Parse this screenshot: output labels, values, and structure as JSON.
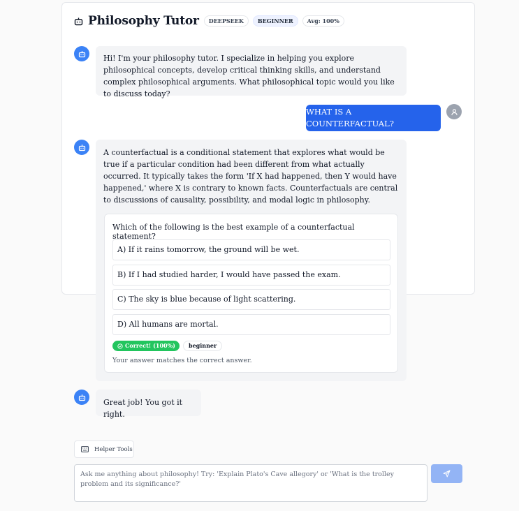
{
  "header": {
    "title": "Philosophy Tutor",
    "badges": [
      "DEEPSEEK",
      "BEGINNER",
      "Avg: 100%"
    ]
  },
  "messages": {
    "intro": "Hi! I'm your philosophy tutor. I specialize in helping you explore philosophical concepts, develop critical thinking skills, and understand complex philosophical arguments. What philosophical topic would you like to discuss today?",
    "user_question": "WHAT IS A COUNTERFACTUAL?",
    "answer": "A counterfactual is a conditional statement that explores what would be true if a particular condition had been different from what actually occurred. It typically takes the form 'If X had happened, then Y would have happened,' where X is contrary to known facts. Counterfactuals are central to discussions of causality, possibility, and modal logic in philosophy.",
    "followup": "Great job! You got it right."
  },
  "quiz": {
    "question": "Which of the following is the best example of a counterfactual statement?",
    "options": [
      "A) If it rains tomorrow, the ground will be wet.",
      "B) If I had studied harder, I would have passed the exam.",
      "C) The sky is blue because of light scattering.",
      "D) All humans are mortal."
    ],
    "result_label": "Correct! (100%)",
    "level_label": "beginner",
    "explanation": "Your answer matches the correct answer."
  },
  "tools": {
    "label": "Helper Tools"
  },
  "input": {
    "placeholder": "Ask me anything about philosophy! Try: 'Explain Plato's Cave allegory' or 'What is the trolley problem and its significance?'"
  },
  "icons": {
    "bot": "robot-icon",
    "user": "user-icon",
    "tools": "keyboard-icon",
    "send": "send-icon",
    "check": "check-circle-icon"
  },
  "colors": {
    "accent": "#2563eb",
    "bot_avatar": "#3b82f6",
    "user_avatar": "#9ca3af",
    "correct": "#22c55e",
    "send_disabled": "#93b4f5"
  }
}
